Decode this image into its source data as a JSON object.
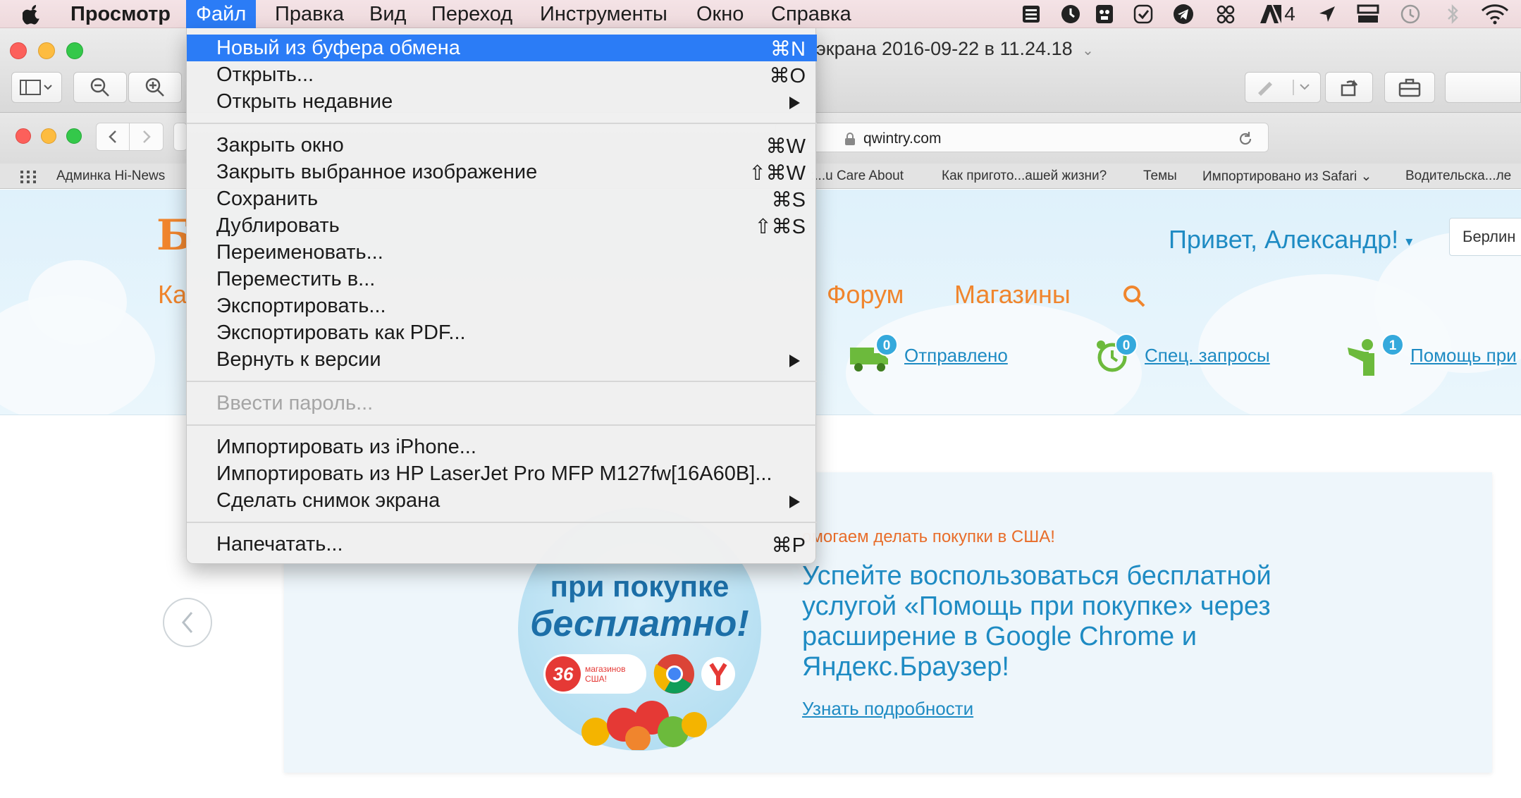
{
  "menubar": {
    "app_name": "Просмотр",
    "items": [
      "Файл",
      "Правка",
      "Вид",
      "Переход",
      "Инструменты",
      "Окно",
      "Справка"
    ],
    "status_icons": [
      "books-icon",
      "time-icon",
      "bear-icon",
      "check-circle-icon",
      "telegram-icon",
      "scissors-icon",
      "adobe-icon",
      "location-arrow-icon",
      "drive-icon",
      "time-machine-icon",
      "bluetooth-icon",
      "wifi-icon"
    ],
    "adobe_count": "4"
  },
  "preview_window": {
    "title": "экрана 2016-09-22 в 11.24.18"
  },
  "safari": {
    "url": "qwintry.com",
    "bookmarks": [
      "Админка Hi-News",
      ":...u Care About",
      "Как пригото...ашей жизни?",
      "Темы",
      "Импортировано из Safari",
      "Водительска...ле"
    ]
  },
  "file_menu": {
    "items": [
      {
        "label": "Новый из буфера обмена",
        "shortcut": "⌘N",
        "highlighted": true
      },
      {
        "label": "Открыть...",
        "shortcut": "⌘O"
      },
      {
        "label": "Открыть недавние",
        "submenu": true
      },
      {
        "label": "Закрыть окно",
        "shortcut": "⌘W"
      },
      {
        "label": "Закрыть выбранное изображение",
        "shortcut": "⇧⌘W"
      },
      {
        "label": "Сохранить",
        "shortcut": "⌘S"
      },
      {
        "label": "Дублировать",
        "shortcut": "⇧⌘S"
      },
      {
        "label": "Переименовать..."
      },
      {
        "label": "Переместить в..."
      },
      {
        "label": "Экспортировать..."
      },
      {
        "label": "Экспортировать как PDF..."
      },
      {
        "label": "Вернуть к версии",
        "submenu": true
      },
      {
        "label": "Ввести пароль...",
        "disabled": true
      },
      {
        "label": "Импортировать из iPhone..."
      },
      {
        "label": "Импортировать из HP LaserJet Pro MFP M127fw[16A60B]..."
      },
      {
        "label": "Сделать снимок экрана",
        "submenu": true
      },
      {
        "label": "Напечатать...",
        "shortcut": "⌘P"
      }
    ]
  },
  "site": {
    "logo_fragment": "Б",
    "greeting": "Привет, Александр!",
    "city": "Берлин",
    "nav": [
      "Ка",
      "Форум",
      "Магазины"
    ],
    "stats": [
      {
        "label": "Отправлено",
        "count": "0"
      },
      {
        "label": "Спец. запросы",
        "count": "0"
      },
      {
        "label": "Помощь при",
        "count": "1"
      }
    ],
    "promo": {
      "kicker": "омогаем делать покупки в США!",
      "body": "Успейте воспользоваться бесплатной услугой «Помощь при покупке» через расширение в Google Chrome и Яндекс.Браузер!",
      "link": "Узнать подробности",
      "circle_line1": "при покупке",
      "circle_line2": "бесплатно!",
      "badge_number": "36",
      "badge_text": "магазинов США!"
    }
  },
  "colors": {
    "menu_highlight": "#2b7cf6",
    "site_orange": "#f0852d",
    "site_blue": "#1e8bc3"
  }
}
